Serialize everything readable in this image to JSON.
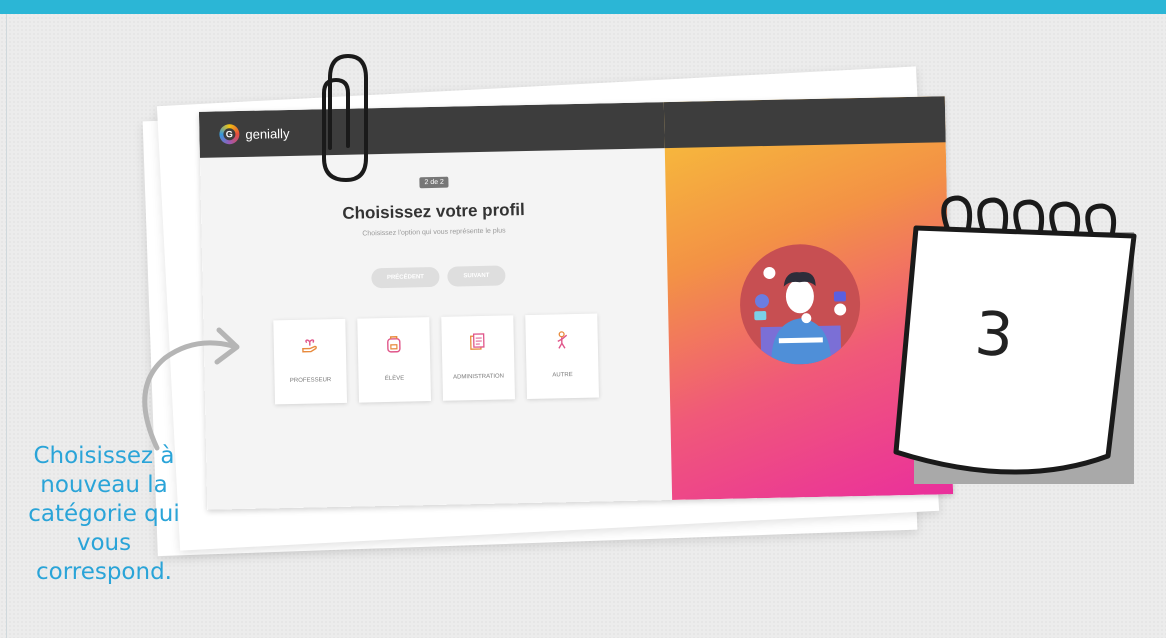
{
  "caption": "Choisissez à nouveau la catégorie qui vous correspond.",
  "calendar": {
    "number": "3"
  },
  "screenshot": {
    "logo_text": "genially",
    "step_badge": "2 de 2",
    "title": "Choisissez votre profil",
    "subtitle": "Choisissez l'option qui vous représente le plus",
    "prev_button": "PRÉCÉDENT",
    "next_button": "SUIVANT",
    "profiles": [
      {
        "label": "PROFESSEUR",
        "icon": "hand-plant-icon"
      },
      {
        "label": "ÉLÈVE",
        "icon": "backpack-icon"
      },
      {
        "label": "ADMINISTRATION",
        "icon": "documents-icon"
      },
      {
        "label": "AUTRE",
        "icon": "person-icon"
      }
    ]
  },
  "colors": {
    "accent": "#2bb6d6",
    "caption": "#2aa4d8",
    "header": "#3d3d3d",
    "gradient_start": "#f7c33a",
    "gradient_end": "#ea2f9c"
  }
}
